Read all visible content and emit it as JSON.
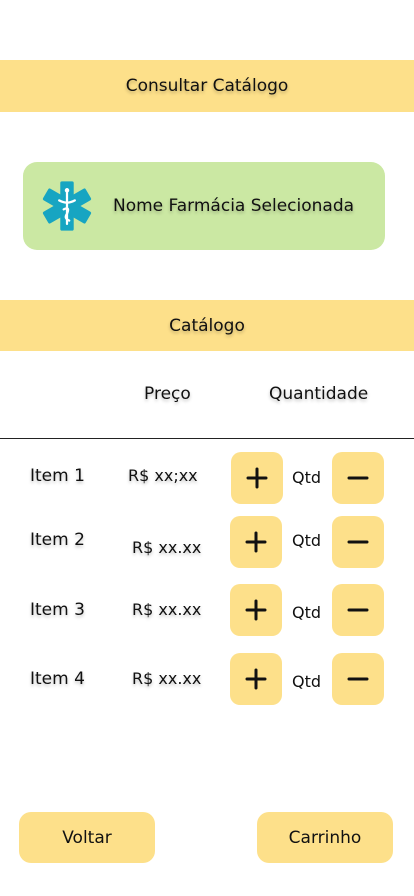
{
  "header": {
    "title": "Consultar Catálogo"
  },
  "pharmacy": {
    "name": "Nome Farmácia Selecionada",
    "icon": "star-of-life-icon",
    "icon_color": "#17a5c2"
  },
  "catalog": {
    "title": "Catálogo",
    "columns": {
      "price": "Preço",
      "quantity": "Quantidade"
    },
    "items": [
      {
        "name": "Item 1",
        "price": "R$ xx;xx",
        "qty_label": "Qtd"
      },
      {
        "name": "Item 2",
        "price": "R$ xx.xx",
        "qty_label": "Qtd"
      },
      {
        "name": "Item 3",
        "price": "R$ xx.xx",
        "qty_label": "Qtd"
      },
      {
        "name": "Item 4",
        "price": "R$ xx.xx",
        "qty_label": "Qtd"
      }
    ]
  },
  "footer": {
    "back_label": "Voltar",
    "cart_label": "Carrinho"
  },
  "colors": {
    "accent": "#fde08a",
    "card": "#cbe8a3"
  }
}
